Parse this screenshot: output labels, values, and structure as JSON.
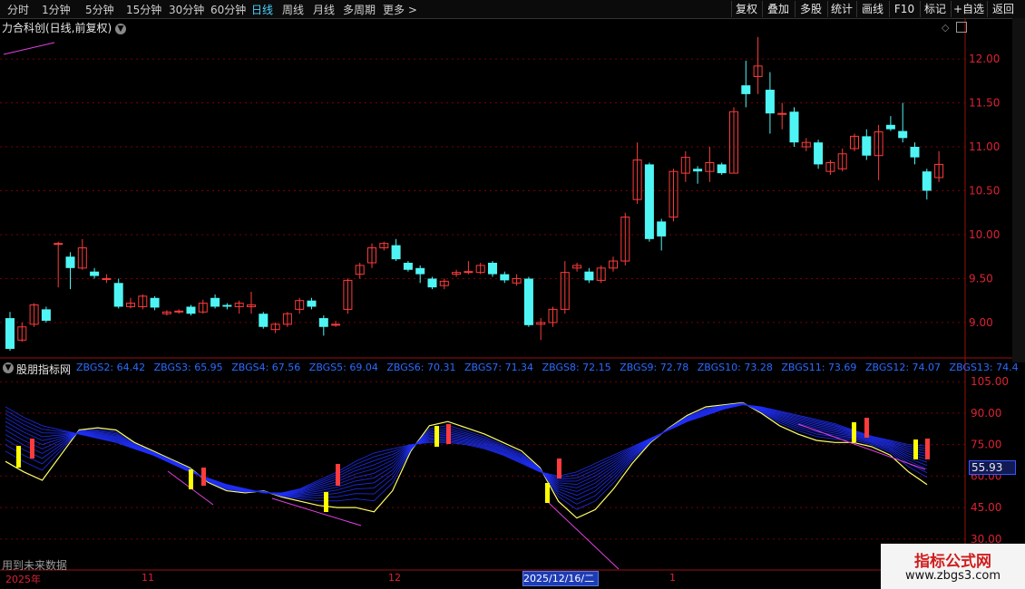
{
  "toolbar": {
    "periods": [
      "分时",
      "1分钟",
      "5分钟",
      "15分钟",
      "30分钟",
      "60分钟",
      "日线",
      "周线",
      "月线",
      "多周期",
      "更多 >"
    ],
    "active_period": "日线",
    "right_buttons": [
      "复权",
      "叠加",
      "多股",
      "统计",
      "画线",
      "F10",
      "标记",
      "+自选",
      "返回"
    ]
  },
  "chart_title": "力合科创(日线,前复权)",
  "indicator": {
    "name": "股朋指标网",
    "values": [
      "ZBGS2: 64.42",
      "ZBGS3: 65.95",
      "ZBGS4: 67.56",
      "ZBGS5: 69.04",
      "ZBGS6: 70.31",
      "ZBGS7: 71.34",
      "ZBGS8: 72.15",
      "ZBGS9: 72.78",
      "ZBGS10: 73.28",
      "ZBGS11: 73.69",
      "ZBGS12: 74.07",
      "ZBGS13: 74.4"
    ],
    "current_value": "55.93",
    "note": "用到未来数据"
  },
  "date_axis": {
    "labels": [
      "2025年",
      "11",
      "12",
      "1"
    ],
    "cursor_date": "2025/12/16/二"
  },
  "watermark": {
    "line1": "指标公式网",
    "line2": "www.zbgs3.com"
  },
  "colors": {
    "up": "#ff3b3b",
    "down": "#4ff5f5",
    "fan": "#2030ff",
    "yellow": "#ffff00",
    "grid": "#7a0000"
  },
  "chart_data": [
    {
      "type": "candlestick",
      "title": "力合科创(日线,前复权)",
      "y_ticks": [
        12.0,
        11.5,
        11.0,
        10.5,
        10.0,
        9.5,
        9.0
      ],
      "ylim": [
        8.7,
        12.3
      ],
      "candles": [
        [
          9.05,
          8.7,
          9.12,
          8.68
        ],
        [
          8.8,
          8.95,
          9.0,
          8.78
        ],
        [
          8.98,
          9.2,
          9.22,
          8.95
        ],
        [
          9.15,
          9.02,
          9.18,
          9.0
        ],
        [
          9.9,
          9.9,
          9.92,
          9.4
        ],
        [
          9.75,
          9.62,
          9.8,
          9.38
        ],
        [
          9.62,
          9.85,
          9.95,
          9.6
        ],
        [
          9.58,
          9.53,
          9.62,
          9.5
        ],
        [
          9.5,
          9.5,
          9.55,
          9.45
        ],
        [
          9.45,
          9.18,
          9.5,
          9.16
        ],
        [
          9.18,
          9.22,
          9.28,
          9.16
        ],
        [
          9.18,
          9.3,
          9.32,
          9.15
        ],
        [
          9.28,
          9.17,
          9.3,
          9.14
        ],
        [
          9.1,
          9.12,
          9.14,
          9.08
        ],
        [
          9.12,
          9.13,
          9.15,
          9.1
        ],
        [
          9.18,
          9.1,
          9.2,
          9.08
        ],
        [
          9.12,
          9.22,
          9.26,
          9.1
        ],
        [
          9.28,
          9.18,
          9.32,
          9.16
        ],
        [
          9.2,
          9.18,
          9.22,
          9.15
        ],
        [
          9.18,
          9.22,
          9.25,
          9.1
        ],
        [
          9.18,
          9.2,
          9.35,
          9.1
        ],
        [
          9.1,
          8.95,
          9.12,
          8.93
        ],
        [
          8.92,
          8.98,
          9.0,
          8.88
        ],
        [
          8.98,
          9.1,
          9.12,
          8.95
        ],
        [
          9.15,
          9.25,
          9.28,
          9.1
        ],
        [
          9.25,
          9.18,
          9.28,
          9.15
        ],
        [
          9.05,
          8.95,
          9.08,
          8.85
        ],
        [
          8.97,
          8.98,
          9.02,
          8.95
        ],
        [
          9.15,
          9.48,
          9.5,
          9.1
        ],
        [
          9.55,
          9.65,
          9.68,
          9.5
        ],
        [
          9.68,
          9.85,
          9.9,
          9.62
        ],
        [
          9.85,
          9.9,
          9.92,
          9.82
        ],
        [
          9.88,
          9.72,
          9.95,
          9.7
        ],
        [
          9.68,
          9.6,
          9.7,
          9.58
        ],
        [
          9.62,
          9.55,
          9.65,
          9.45
        ],
        [
          9.5,
          9.4,
          9.52,
          9.38
        ],
        [
          9.42,
          9.47,
          9.5,
          9.38
        ],
        [
          9.55,
          9.57,
          9.6,
          9.52
        ],
        [
          9.58,
          9.58,
          9.7,
          9.55
        ],
        [
          9.57,
          9.65,
          9.68,
          9.55
        ],
        [
          9.68,
          9.55,
          9.7,
          9.52
        ],
        [
          9.55,
          9.48,
          9.58,
          9.45
        ],
        [
          9.45,
          9.5,
          9.55,
          9.42
        ],
        [
          9.5,
          8.97,
          9.52,
          8.95
        ],
        [
          8.98,
          9.0,
          9.05,
          8.8
        ],
        [
          9.0,
          9.15,
          9.18,
          8.95
        ],
        [
          9.15,
          9.57,
          9.7,
          9.1
        ],
        [
          9.62,
          9.65,
          9.68,
          9.58
        ],
        [
          9.58,
          9.48,
          9.62,
          9.45
        ],
        [
          9.48,
          9.62,
          9.65,
          9.45
        ],
        [
          9.62,
          9.7,
          9.75,
          9.58
        ],
        [
          9.7,
          10.2,
          10.25,
          9.65
        ],
        [
          10.4,
          10.85,
          11.05,
          10.35
        ],
        [
          10.8,
          9.95,
          10.82,
          9.92
        ],
        [
          10.15,
          9.98,
          10.18,
          9.82
        ],
        [
          10.2,
          10.72,
          10.75,
          10.15
        ],
        [
          10.7,
          10.88,
          10.95,
          10.6
        ],
        [
          10.75,
          10.72,
          10.78,
          10.58
        ],
        [
          10.72,
          10.82,
          11.0,
          10.6
        ],
        [
          10.8,
          10.7,
          10.82,
          10.68
        ],
        [
          10.7,
          11.4,
          11.45,
          10.7
        ],
        [
          11.7,
          11.6,
          11.98,
          11.45
        ],
        [
          11.8,
          11.92,
          12.25,
          11.6
        ],
        [
          11.65,
          11.38,
          11.85,
          11.15
        ],
        [
          11.38,
          11.38,
          11.5,
          11.2
        ],
        [
          11.4,
          11.05,
          11.45,
          11.0
        ],
        [
          11.0,
          11.05,
          11.1,
          10.95
        ],
        [
          11.05,
          10.8,
          11.08,
          10.75
        ],
        [
          10.72,
          10.82,
          10.85,
          10.68
        ],
        [
          10.75,
          10.92,
          10.98,
          10.72
        ],
        [
          10.98,
          11.12,
          11.15,
          10.95
        ],
        [
          11.12,
          10.9,
          11.2,
          10.85
        ],
        [
          10.9,
          11.17,
          11.25,
          10.62
        ],
        [
          11.25,
          11.2,
          11.35,
          11.18
        ],
        [
          11.18,
          11.1,
          11.5,
          11.05
        ],
        [
          11.0,
          10.88,
          11.05,
          10.8
        ],
        [
          10.72,
          10.5,
          10.75,
          10.4
        ],
        [
          10.65,
          10.8,
          10.95,
          10.6
        ]
      ]
    },
    {
      "type": "line",
      "title": "股朋指标网",
      "y_ticks": [
        105.0,
        90.0,
        75.0,
        60.0,
        45.0,
        30.0
      ],
      "ylim": [
        20,
        112
      ],
      "series": [
        {
          "name": "ZBGS2",
          "values": [
            67,
            62,
            58,
            70,
            82,
            83,
            82,
            76,
            72,
            68,
            64,
            57,
            53,
            52,
            53,
            50,
            48,
            46,
            45,
            45,
            43,
            53,
            72,
            84,
            86,
            83,
            80,
            76,
            72,
            64,
            48,
            40,
            44,
            54,
            66,
            76,
            83,
            89,
            93,
            94,
            95,
            90,
            84,
            80,
            77,
            76,
            76,
            74,
            70,
            62,
            56
          ]
        },
        {
          "name": "ZBGS13",
          "values": [
            93,
            88,
            84,
            82,
            80,
            78,
            76,
            73,
            70,
            66,
            62,
            59,
            56,
            54,
            52,
            52,
            54,
            58,
            62,
            67,
            71,
            73,
            75,
            76,
            76,
            75,
            73,
            70,
            66,
            62,
            60,
            62,
            66,
            70,
            74,
            78,
            82,
            86,
            89,
            92,
            94,
            93,
            91,
            89,
            87,
            85,
            82,
            79,
            77,
            75,
            74.4
          ]
        }
      ]
    }
  ]
}
